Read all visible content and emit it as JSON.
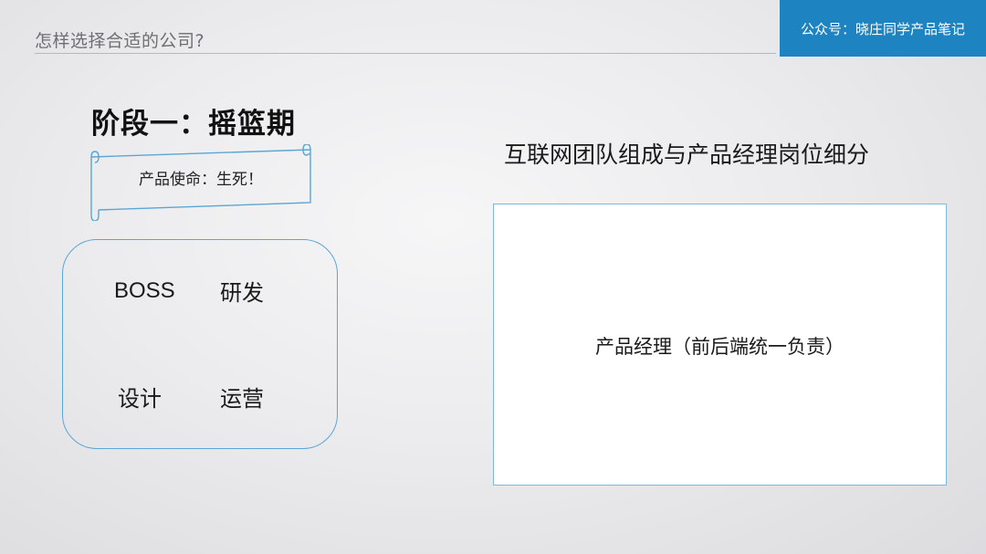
{
  "header": {
    "title": "怎样选择合适的公司?",
    "brand": "公众号：晓庄同学产品笔记"
  },
  "stage": {
    "title": "阶段一：摇篮期",
    "mission": "产品使命：生死！"
  },
  "team": {
    "roles": [
      "BOSS",
      "研发",
      "设计",
      "运营"
    ]
  },
  "right": {
    "title": "互联网团队组成与产品经理岗位细分",
    "pm_text": "产品经理（前后端统一负责）"
  },
  "colors": {
    "accent": "#1e83c1",
    "border": "#5aa6d6"
  }
}
